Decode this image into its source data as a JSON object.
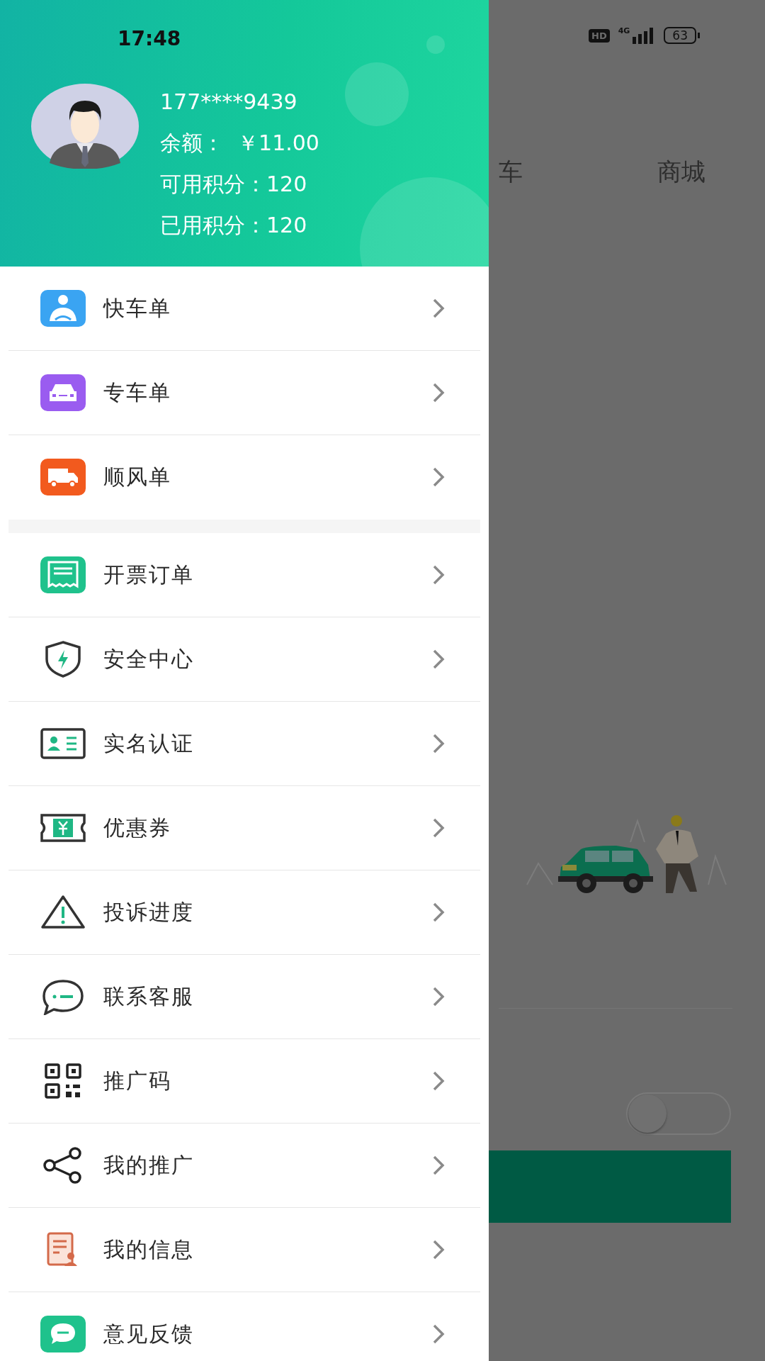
{
  "status_bar": {
    "time": "17:48",
    "badge": "HD",
    "network": "4G",
    "battery": "63"
  },
  "profile": {
    "phone": "177****9439",
    "balance": "余额：  ￥11.00",
    "available_points": "可用积分：120",
    "used_points": "已用积分：120"
  },
  "order_menu": [
    {
      "label": "快车单"
    },
    {
      "label": "专车单"
    },
    {
      "label": "顺风单"
    }
  ],
  "service_menu": [
    {
      "label": "开票订单"
    },
    {
      "label": "安全中心"
    },
    {
      "label": "实名认证"
    },
    {
      "label": "优惠券"
    },
    {
      "label": "投诉进度"
    },
    {
      "label": "联系客服"
    },
    {
      "label": "推广码"
    },
    {
      "label": "我的推广"
    },
    {
      "label": "我的信息"
    },
    {
      "label": "意见反馈"
    }
  ],
  "background_screen": {
    "tabs": [
      {
        "label": "车"
      },
      {
        "label": "商城"
      }
    ],
    "toggle": {
      "on": false
    }
  }
}
